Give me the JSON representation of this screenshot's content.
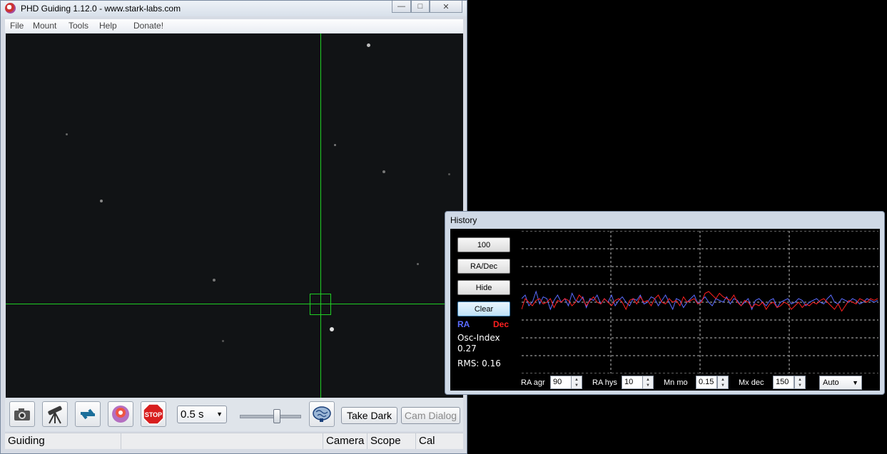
{
  "main_window": {
    "title": "PHD Guiding 1.12.0  -  www.stark-labs.com",
    "menu": [
      "File",
      "Mount",
      "Tools",
      "Help",
      "Donate!"
    ],
    "toolbar": {
      "icons": [
        "camera-icon",
        "telescope-icon",
        "loop-icon",
        "phd-guide-icon",
        "stop-icon",
        "brain-icon"
      ],
      "exposure_value": "0.5 s",
      "take_dark_label": "Take Dark",
      "cam_dialog_label": "Cam Dialog"
    },
    "status": {
      "mode": "Guiding",
      "camera": "Camera",
      "scope": "Scope",
      "cal": "Cal"
    }
  },
  "history": {
    "title": "History",
    "buttons": [
      "100",
      "RA/Dec",
      "Hide",
      "Clear"
    ],
    "legend_ra": "RA",
    "legend_dec": "Dec",
    "osc_label": "Osc-Index",
    "osc_value": "0.27",
    "rms_text": "RMS: 0.16",
    "params": [
      {
        "label": "RA agr",
        "value": "90"
      },
      {
        "label": "RA hys",
        "value": "10"
      },
      {
        "label": "Mn mo",
        "value": "0.15"
      },
      {
        "label": "Mx dec",
        "value": "150"
      }
    ],
    "mode_value": "Auto",
    "colors": {
      "ra": "#5a6cff",
      "dec": "#ff2020",
      "grid": "#bbbbbb"
    }
  },
  "chart_data": {
    "type": "line",
    "series": [
      {
        "name": "RA",
        "values": [
          0.1,
          0.2,
          -0.1,
          0.0,
          0.3,
          -0.05,
          0.15,
          0.1,
          -0.2,
          0.05,
          0.2,
          0.0,
          0.1,
          -0.1,
          0.25,
          0.05,
          0.0,
          0.15,
          -0.15,
          0.1,
          0.05,
          0.2,
          -0.05,
          0.1,
          0.0,
          0.2,
          -0.1,
          0.05,
          0.15,
          0.0,
          -0.1,
          0.1,
          0.05,
          0.2,
          -0.05,
          0.0,
          0.15,
          0.1,
          -0.1,
          0.05,
          0.2,
          0.0,
          -0.2,
          0.1,
          0.05,
          -0.15,
          0.0,
          0.1,
          0.2,
          -0.05,
          0.05,
          0.15,
          0.0,
          -0.1,
          0.1,
          0.05,
          0.0,
          0.15,
          -0.05,
          0.1,
          0.05,
          -0.1,
          0.0,
          0.1,
          -0.2,
          0.05,
          0.1,
          0.0,
          -0.1,
          0.05,
          0.1,
          -0.15,
          0.0,
          0.05,
          0.1,
          -0.05,
          0.0,
          0.1,
          0.05,
          -0.1,
          0.0,
          0.05,
          0.1,
          0.0,
          -0.05,
          0.1,
          0.2,
          0.0,
          -0.05,
          0.1,
          0.05,
          0.0,
          0.1,
          0.05,
          -0.05,
          0.0,
          0.1,
          0.05,
          0.0,
          0.05
        ]
      },
      {
        "name": "Dec",
        "values": [
          -0.2,
          0.1,
          0.0,
          -0.1,
          0.05,
          0.1,
          -0.05,
          0.0,
          0.1,
          -0.15,
          0.05,
          0.0,
          0.1,
          0.05,
          -0.1,
          0.0,
          0.2,
          0.1,
          -0.1,
          0.05,
          0.15,
          0.0,
          -0.05,
          0.1,
          0.0,
          -0.1,
          0.05,
          0.1,
          0.0,
          -0.2,
          0.05,
          0.1,
          -0.05,
          0.15,
          0.0,
          0.05,
          -0.1,
          0.1,
          0.2,
          0.0,
          -0.05,
          0.1,
          0.0,
          0.05,
          -0.1,
          0.15,
          0.0,
          0.05,
          0.1,
          -0.05,
          0.0,
          0.25,
          0.3,
          0.2,
          0.1,
          0.25,
          0.15,
          0.1,
          0.05,
          0.2,
          0.0,
          -0.1,
          0.05,
          0.0,
          -0.15,
          -0.05,
          -0.1,
          0.0,
          -0.2,
          -0.05,
          0.0,
          -0.15,
          -0.1,
          0.0,
          -0.05,
          -0.2,
          -0.1,
          0.0,
          -0.15,
          -0.05,
          -0.1,
          0.0,
          -0.05,
          0.05,
          0.1,
          0.0,
          -0.1,
          -0.2,
          -0.05,
          -0.25,
          -0.1,
          0.05,
          0.0,
          -0.05,
          0.1,
          0.05,
          0.0,
          0.1,
          0.05,
          0.1
        ]
      }
    ],
    "ylim": [
      -2,
      2
    ],
    "grid": true
  }
}
